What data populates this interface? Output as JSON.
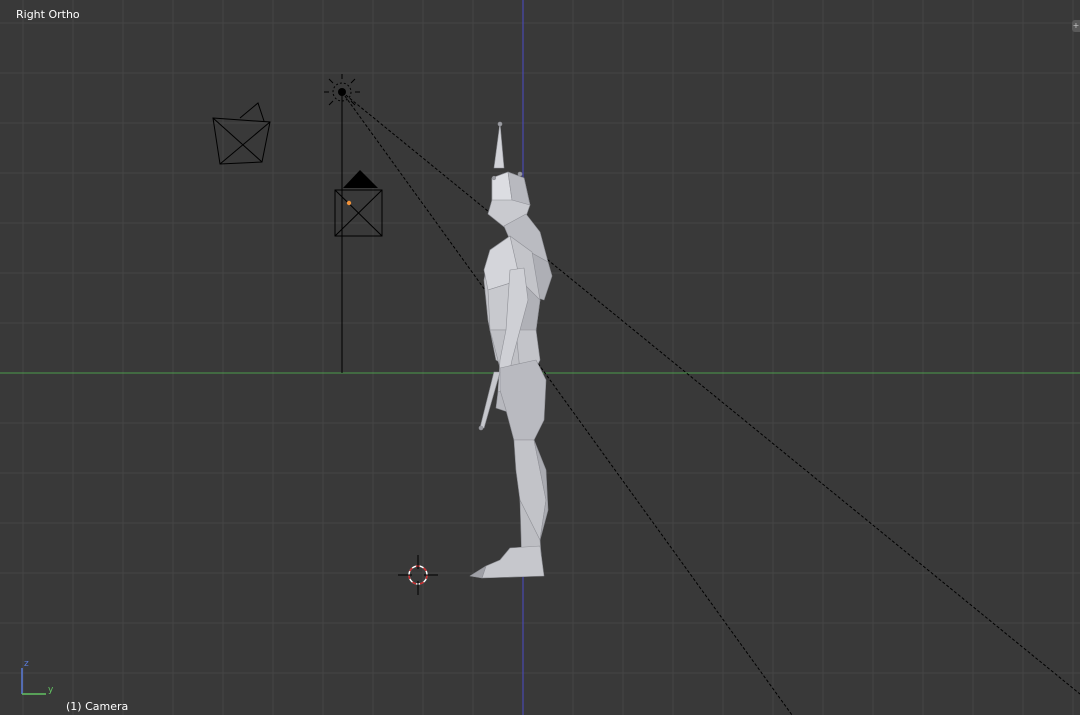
{
  "viewport": {
    "view_label": "Right Ortho",
    "object_label": "(1) Camera",
    "axis_z_label": "z",
    "axis_y_label": "y",
    "corner_widget_glyph": "+"
  },
  "colors": {
    "background": "#393939",
    "grid": "#454545",
    "axis_y_line": "#4c9b4c",
    "axis_z_line": "#4a4ac8",
    "mesh": "#b9bac0",
    "wire": "#000000",
    "origin_dot": "#f0923a",
    "cursor_red": "#c8282a"
  },
  "icons": {
    "lamp": "sun-lamp-icon",
    "camera_main": "camera-object-icon",
    "camera_alt": "camera-outline-icon",
    "cursor": "3d-cursor-icon",
    "gizmo": "axis-gizmo-icon"
  }
}
